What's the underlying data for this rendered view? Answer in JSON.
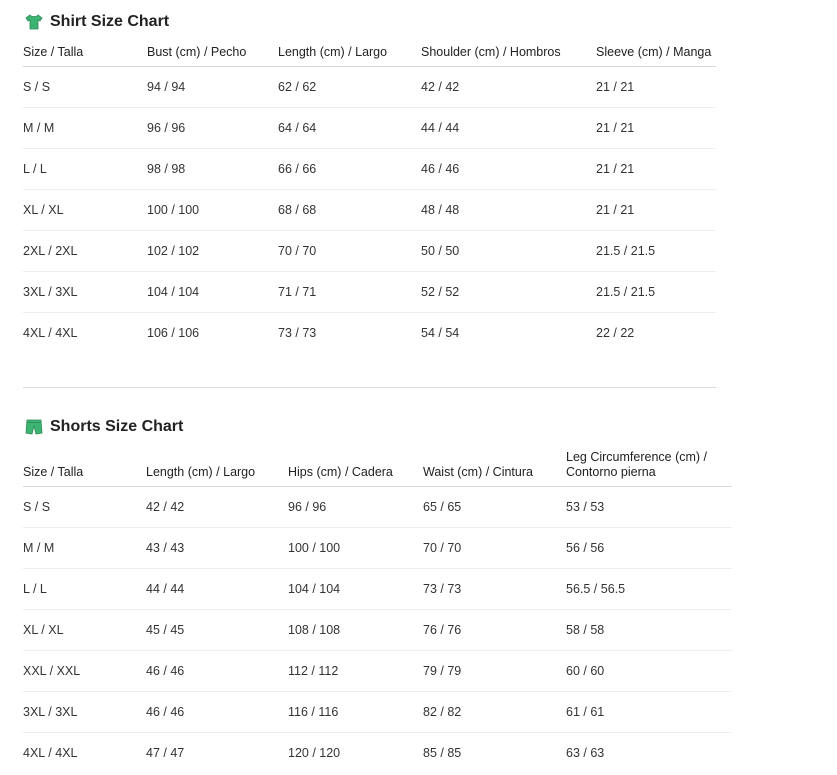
{
  "shirt": {
    "title": "Shirt Size Chart",
    "icon": "shirt-icon",
    "icon_color": "#3cb371",
    "headers": [
      "Size / Talla",
      "Bust (cm) / Pecho",
      "Length (cm) / Largo",
      "Shoulder (cm) / Hombros",
      "Sleeve (cm) / Manga"
    ],
    "rows": [
      [
        "S / S",
        "94 / 94",
        "62 / 62",
        "42 / 42",
        "21 / 21"
      ],
      [
        "M / M",
        "96 / 96",
        "64 / 64",
        "44 / 44",
        "21 / 21"
      ],
      [
        "L / L",
        "98 / 98",
        "66 / 66",
        "46 / 46",
        "21 / 21"
      ],
      [
        "XL / XL",
        "100 / 100",
        "68 / 68",
        "48 / 48",
        "21 / 21"
      ],
      [
        "2XL / 2XL",
        "102 / 102",
        "70 / 70",
        "50 / 50",
        "21.5 / 21.5"
      ],
      [
        "3XL / 3XL",
        "104 / 104",
        "71 / 71",
        "52 / 52",
        "21.5 / 21.5"
      ],
      [
        "4XL / 4XL",
        "106 / 106",
        "73 / 73",
        "54 / 54",
        "22 / 22"
      ]
    ]
  },
  "shorts": {
    "title": "Shorts Size Chart",
    "icon": "shorts-icon",
    "icon_color": "#3cb371",
    "headers": [
      "Size / Talla",
      "Length (cm) / Largo",
      "Hips (cm) / Cadera",
      "Waist (cm) / Cintura",
      "Leg Circumference (cm) / Contorno pierna"
    ],
    "rows": [
      [
        "S / S",
        "42 / 42",
        "96 / 96",
        "65 / 65",
        "53 / 53"
      ],
      [
        "M / M",
        "43 / 43",
        "100 / 100",
        "70 / 70",
        "56 / 56"
      ],
      [
        "L / L",
        "44 / 44",
        "104 / 104",
        "73 / 73",
        "56.5 / 56.5"
      ],
      [
        "XL / XL",
        "45 / 45",
        "108 / 108",
        "76 / 76",
        "58 / 58"
      ],
      [
        "XXL / XXL",
        "46 / 46",
        "112 / 112",
        "79 / 79",
        "60 / 60"
      ],
      [
        "3XL / 3XL",
        "46 / 46",
        "116 / 116",
        "82 / 82",
        "61 / 61"
      ],
      [
        "4XL / 4XL",
        "47 / 47",
        "120 / 120",
        "85 / 85",
        "63 / 63"
      ]
    ]
  }
}
